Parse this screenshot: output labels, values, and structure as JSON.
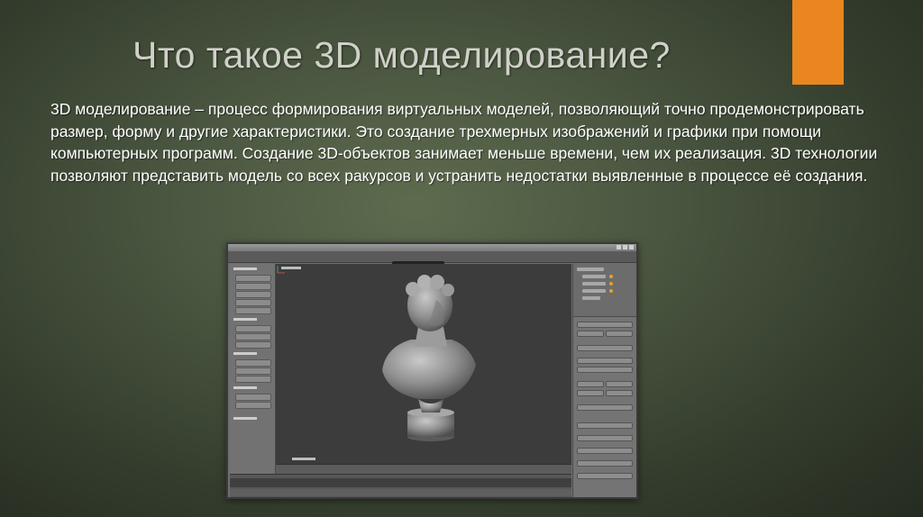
{
  "slide": {
    "title": "Что такое 3D моделирование?",
    "body": "3D моделирование – процесс формирования виртуальных моделей, позволяющий точно продемонстрировать размер, форму и другие характеристики. Это создание трехмерных изображений и графики при помощи компьютерных программ. Создание 3D-объектов занимает меньше времени, чем их реализация. 3D технологии позволяют представить модель со всех ракурсов и устранить недостатки выявленные в процессе её создания."
  },
  "colors": {
    "accent": "#e9861f",
    "title_text": "#cfd1c9",
    "body_text": "#ffffff",
    "background": "#4a5640"
  },
  "figure": {
    "subject": "3D bust model in modeling software viewport",
    "icons": [
      "sculpture-bust",
      "axis-gizmo",
      "window-controls"
    ]
  }
}
